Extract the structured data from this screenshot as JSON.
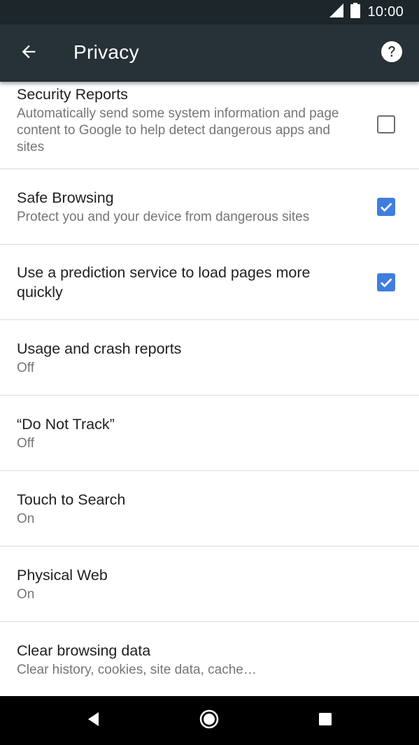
{
  "status_bar": {
    "time": "10:00"
  },
  "app_bar": {
    "title": "Privacy"
  },
  "items": [
    {
      "title": "Security Reports",
      "summary": "Automatically send some system information and page content to Google to help detect dangerous apps and sites",
      "checkbox": false
    },
    {
      "title": "Safe Browsing",
      "summary": "Protect you and your device from dangerous sites",
      "checkbox": true
    },
    {
      "title": "Use a prediction service to load pages more quickly",
      "summary": "",
      "checkbox": true
    },
    {
      "title": "Usage and crash reports",
      "summary": "Off"
    },
    {
      "title": "“Do Not Track”",
      "summary": "Off"
    },
    {
      "title": "Touch to Search",
      "summary": "On"
    },
    {
      "title": "Physical Web",
      "summary": "On"
    },
    {
      "title": "Clear browsing data",
      "summary": "Clear history, cookies, site data, cache…"
    }
  ],
  "colors": {
    "app_bar": "#263238",
    "status_bar": "#1c262b",
    "checkbox_on": "#3f7ee0"
  },
  "icons": {
    "back": "arrow-left-icon",
    "help": "help-icon",
    "signal": "signal-icon",
    "battery": "battery-icon",
    "nav_back": "nav-back-icon",
    "nav_home": "nav-home-icon",
    "nav_recents": "nav-recents-icon"
  }
}
